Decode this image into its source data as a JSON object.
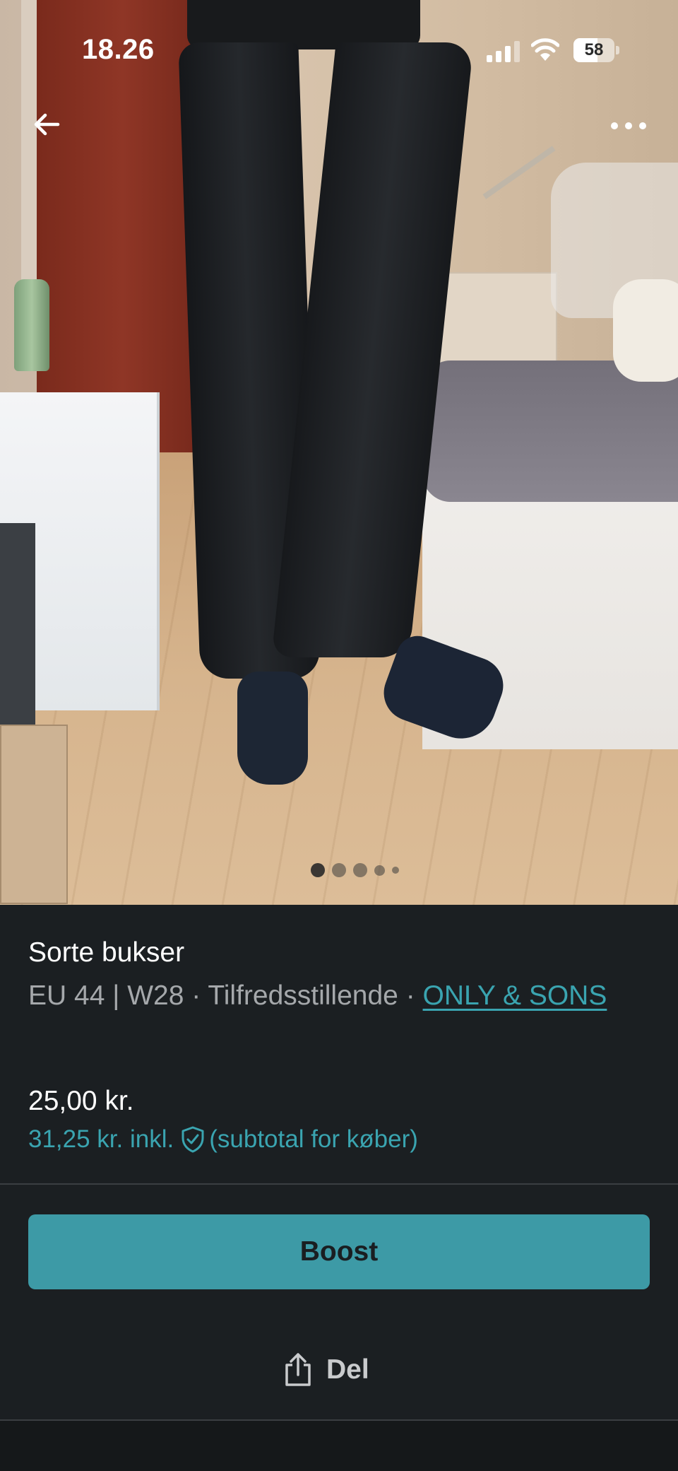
{
  "status_bar": {
    "time": "18.26",
    "battery": "58",
    "icons": [
      "signal-icon",
      "wifi-icon",
      "battery-icon"
    ]
  },
  "photo": {
    "alt": "Sorte bukser",
    "carousel": {
      "count": 5,
      "active_index": 0
    }
  },
  "nav": {
    "back_icon": "arrow-left-icon",
    "more_icon": "ellipsis-icon"
  },
  "listing": {
    "title": "Sorte bukser",
    "size": "EU 44 | W28",
    "separator": " · ",
    "condition": "Tilfredsstillende",
    "brand": "ONLY & SONS",
    "price": "25,00 kr.",
    "subtotal_price": "31,25 kr. inkl.",
    "subtotal_note": "(subtotal for køber)",
    "shield_icon": "shield-check-icon"
  },
  "actions": {
    "boost_label": "Boost",
    "share_label": "Del",
    "share_icon": "share-icon"
  },
  "colors": {
    "accent": "#3d9aa6",
    "link": "#3aa4b0",
    "background": "#1b1f22",
    "muted_text": "#a5a8ab"
  }
}
